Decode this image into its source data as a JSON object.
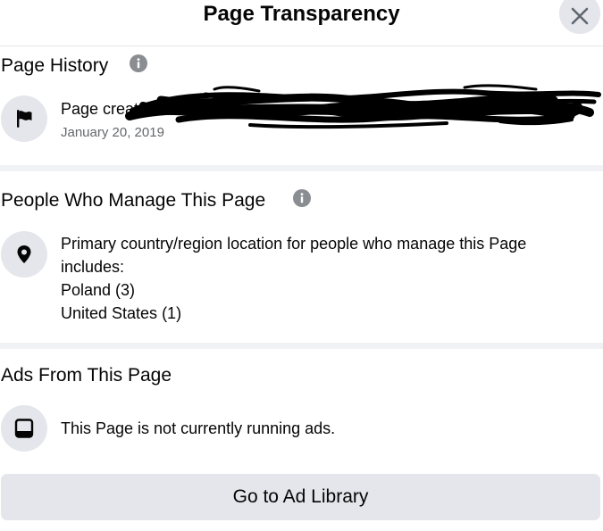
{
  "header": {
    "title": "Page Transparency"
  },
  "page_history": {
    "title": "Page History",
    "info_icon": "info-icon",
    "created_label": "Page created",
    "created_date": "January 20, 2019",
    "icon": "flag-icon"
  },
  "managers": {
    "title": "People Who Manage This Page",
    "info_icon": "info-icon",
    "icon": "location-pin-icon",
    "description_line1": "Primary country/region location for people who manage this Page",
    "description_line2": "includes:",
    "countries": [
      "Poland (3)",
      "United States (1)"
    ]
  },
  "ads": {
    "title": "Ads From This Page",
    "icon": "tablet-icon",
    "status": "This Page is not currently running ads."
  },
  "actions": {
    "ad_library_button": "Go to Ad Library"
  },
  "colors": {
    "text_primary": "#050505",
    "text_secondary": "#65676b",
    "button_bg": "#e4e6eb",
    "icon_grey": "#8a8d91",
    "divider": "#f0f2f5"
  }
}
